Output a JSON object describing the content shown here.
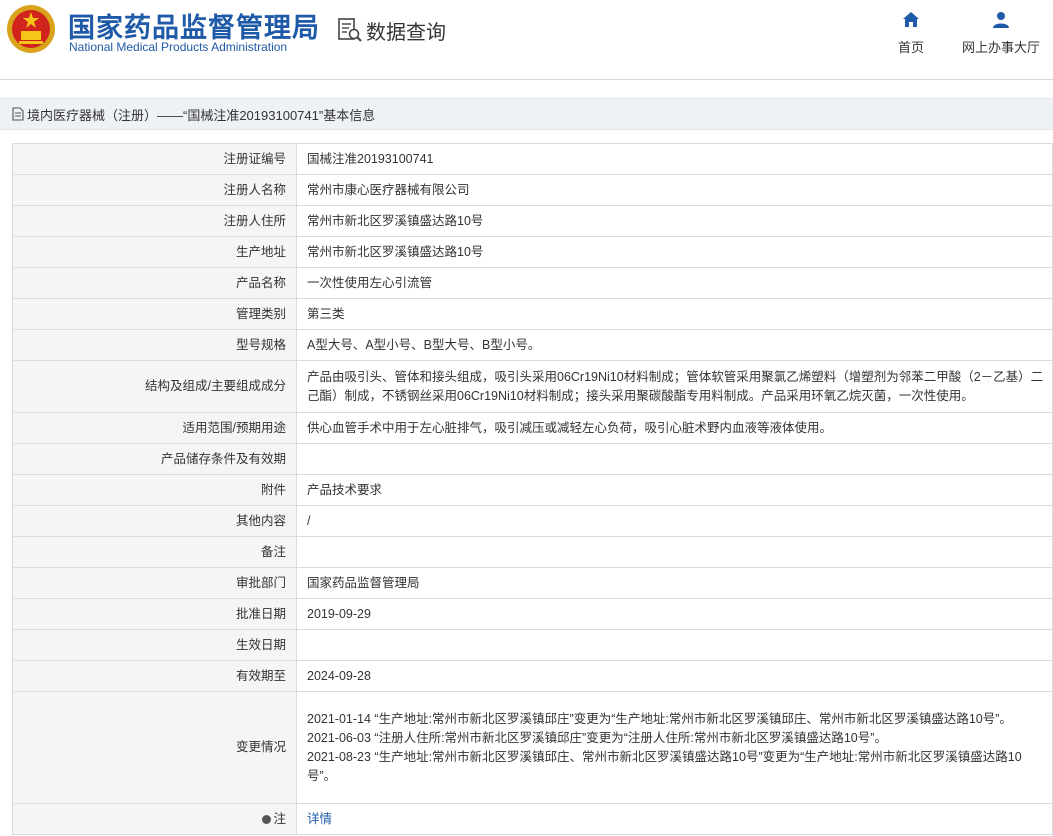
{
  "header": {
    "brand_cn": "国家药品监督管理局",
    "brand_en": "National Medical Products Administration",
    "query_label": "数据查询",
    "nav_home": "首页",
    "nav_office": "网上办事大厅",
    "brand_color": "#1f5aa8"
  },
  "section": {
    "title": "境内医疗器械（注册）——“国械注准20193100741”基本信息"
  },
  "rows": [
    {
      "label": "注册证编号",
      "value": "国械注准20193100741"
    },
    {
      "label": "注册人名称",
      "value": "常州市康心医疗器械有限公司"
    },
    {
      "label": "注册人住所",
      "value": "常州市新北区罗溪镇盛达路10号"
    },
    {
      "label": "生产地址",
      "value": "常州市新北区罗溪镇盛达路10号"
    },
    {
      "label": "产品名称",
      "value": "一次性使用左心引流管"
    },
    {
      "label": "管理类别",
      "value": "第三类"
    },
    {
      "label": "型号规格",
      "value": "A型大号、A型小号、B型大号、B型小号。"
    },
    {
      "label": "结构及组成/主要组成成分",
      "value": "产品由吸引头、管体和接头组成，吸引头采用06Cr19Ni10材料制成；管体软管采用聚氯乙烯塑料（增塑剂为邻苯二甲酸（2－乙基）二己酯）制成，不锈钢丝采用06Cr19Ni10材料制成；接头采用聚碳酸酯专用料制成。产品采用环氧乙烷灭菌，一次性使用。"
    },
    {
      "label": "适用范围/预期用途",
      "value": "供心血管手术中用于左心脏排气，吸引减压或减轻左心负荷，吸引心脏术野内血液等液体使用。"
    },
    {
      "label": "产品储存条件及有效期",
      "value": ""
    },
    {
      "label": "附件",
      "value": "产品技术要求"
    },
    {
      "label": "其他内容",
      "value": "/"
    },
    {
      "label": "备注",
      "value": ""
    },
    {
      "label": "审批部门",
      "value": "国家药品监督管理局"
    },
    {
      "label": "批准日期",
      "value": "2019-09-29"
    },
    {
      "label": "生效日期",
      "value": ""
    },
    {
      "label": "有效期至",
      "value": "2024-09-28"
    }
  ],
  "changes": {
    "label": "变更情况",
    "items": [
      "2021-01-14 “生产地址:常州市新北区罗溪镇邱庄”变更为“生产地址:常州市新北区罗溪镇邱庄、常州市新北区罗溪镇盛达路10号”。",
      "2021-06-03 “注册人住所:常州市新北区罗溪镇邱庄”变更为“注册人住所:常州市新北区罗溪镇盛达路10号”。",
      "2021-08-23 “生产地址:常州市新北区罗溪镇邱庄、常州市新北区罗溪镇盛达路10号”变更为“生产地址:常州市新北区罗溪镇盛达路10号”。"
    ]
  },
  "note": {
    "label": "注",
    "link": "详情"
  }
}
